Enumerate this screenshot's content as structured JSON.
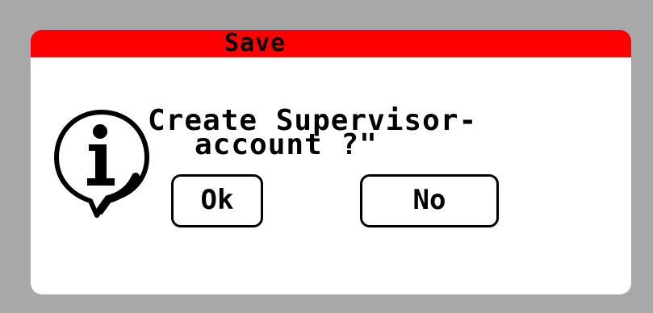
{
  "dialog": {
    "title": "Save",
    "message_line1": "Create Supervisor-",
    "message_line2": "account ?\"",
    "icon": "info-speech-bubble-icon",
    "ok_label": "Ok",
    "no_label": "No"
  },
  "colors": {
    "background": "#a8a8a8",
    "dialog_background": "#ffffff",
    "title_bar": "#ff0000",
    "text": "#000000"
  }
}
